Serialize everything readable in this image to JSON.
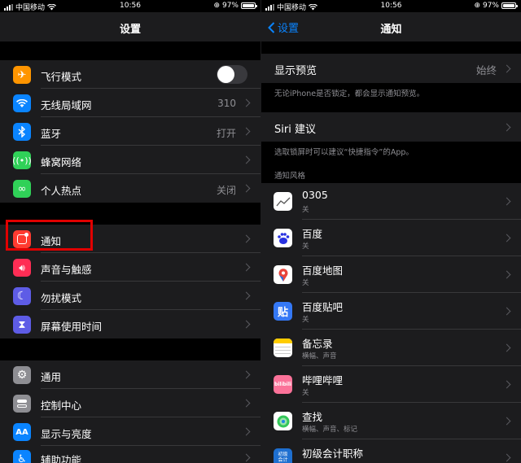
{
  "status": {
    "carrier": "中国移动",
    "time": "10:56",
    "battery": "97%",
    "battery_level": 0.97
  },
  "left": {
    "title": "设置",
    "rows": [
      {
        "label": "飞行模式",
        "value": "",
        "icon": "airplane-icon",
        "color": "#ff9500"
      },
      {
        "label": "无线局域网",
        "value": "310",
        "icon": "wifi-icon",
        "color": "#0a84ff"
      },
      {
        "label": "蓝牙",
        "value": "打开",
        "icon": "bluetooth-icon",
        "color": "#0a84ff"
      },
      {
        "label": "蜂窝网络",
        "value": "",
        "icon": "cellular-icon",
        "color": "#30d158"
      },
      {
        "label": "个人热点",
        "value": "关闭",
        "icon": "hotspot-icon",
        "color": "#30d158"
      },
      {
        "label": "通知",
        "value": "",
        "icon": "notifications-icon",
        "color": "#ff3b30"
      },
      {
        "label": "声音与触感",
        "value": "",
        "icon": "sound-icon",
        "color": "#ff2d55"
      },
      {
        "label": "勿扰模式",
        "value": "",
        "icon": "moon-icon",
        "color": "#5e5ce6"
      },
      {
        "label": "屏幕使用时间",
        "value": "",
        "icon": "hourglass-icon",
        "color": "#5e5ce6"
      },
      {
        "label": "通用",
        "value": "",
        "icon": "gear-icon",
        "color": "#8e8e93"
      },
      {
        "label": "控制中心",
        "value": "",
        "icon": "toggles-icon",
        "color": "#8e8e93"
      },
      {
        "label": "显示与亮度",
        "value": "",
        "icon": "display-icon",
        "color": "#0a84ff"
      },
      {
        "label": "辅助功能",
        "value": "",
        "icon": "accessibility-icon",
        "color": "#0a84ff"
      }
    ]
  },
  "right": {
    "back_label": "设置",
    "title": "通知",
    "preview_label": "显示预览",
    "preview_value": "始终",
    "preview_footer": "无论iPhone是否锁定，都会显示通知预览。",
    "siri_label": "Siri 建议",
    "siri_footer": "选取锁屏时可以建议“快捷指令”的App。",
    "style_header": "通知风格",
    "apps": [
      {
        "name": "0305",
        "sub": "关",
        "icon": "chart-app-icon",
        "color": "#ffffff"
      },
      {
        "name": "百度",
        "sub": "关",
        "icon": "baidu-icon",
        "color": "#ffffff"
      },
      {
        "name": "百度地图",
        "sub": "关",
        "icon": "baidu-map-icon",
        "color": "#ffffff"
      },
      {
        "name": "百度贴吧",
        "sub": "关",
        "icon": "tieba-icon",
        "color": "#3478f6"
      },
      {
        "name": "备忘录",
        "sub": "横幅、声音",
        "icon": "notes-icon",
        "color": "#ffffff"
      },
      {
        "name": "哔哩哔哩",
        "sub": "关",
        "icon": "bilibili-icon",
        "color": "#fb7299"
      },
      {
        "name": "查找",
        "sub": "横幅、声音、标记",
        "icon": "find-my-icon",
        "color": "#ffffff"
      },
      {
        "name": "初级会计职称",
        "sub": "",
        "icon": "accounting-icon",
        "color": "#1e6fd0"
      }
    ],
    "icon_text": {
      "tieba": "贴",
      "bilibili": "bilibili",
      "accounting": "初级\n会计"
    }
  }
}
